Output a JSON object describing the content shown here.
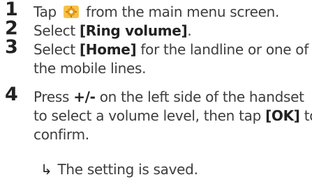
{
  "steps": [
    {
      "number": "1",
      "text_before": "Tap",
      "icon": "settings-icon",
      "text_after": "from the main menu screen."
    },
    {
      "number": "2",
      "text_before": "Select ",
      "bold": "[Ring volume]",
      "text_after": "."
    },
    {
      "number": "3",
      "text_before": "Select ",
      "bold": "[Home]",
      "text_after": " for the landline or one of",
      "line2": "the mobile lines."
    },
    {
      "number": "4",
      "line1_pre": "Press ",
      "line1_bold": "+/-",
      "line1_post": " on the left side of the handset",
      "line2_pre": "to select a volume level, then tap ",
      "line2_bold": "[OK]",
      "line2_post": " to",
      "line3": "confirm."
    }
  ],
  "result": {
    "arrow": "↳",
    "text": "The setting is saved."
  },
  "colors": {
    "text": "#3d3d3d",
    "number": "#222222",
    "icon_accent": "#f0a010"
  }
}
